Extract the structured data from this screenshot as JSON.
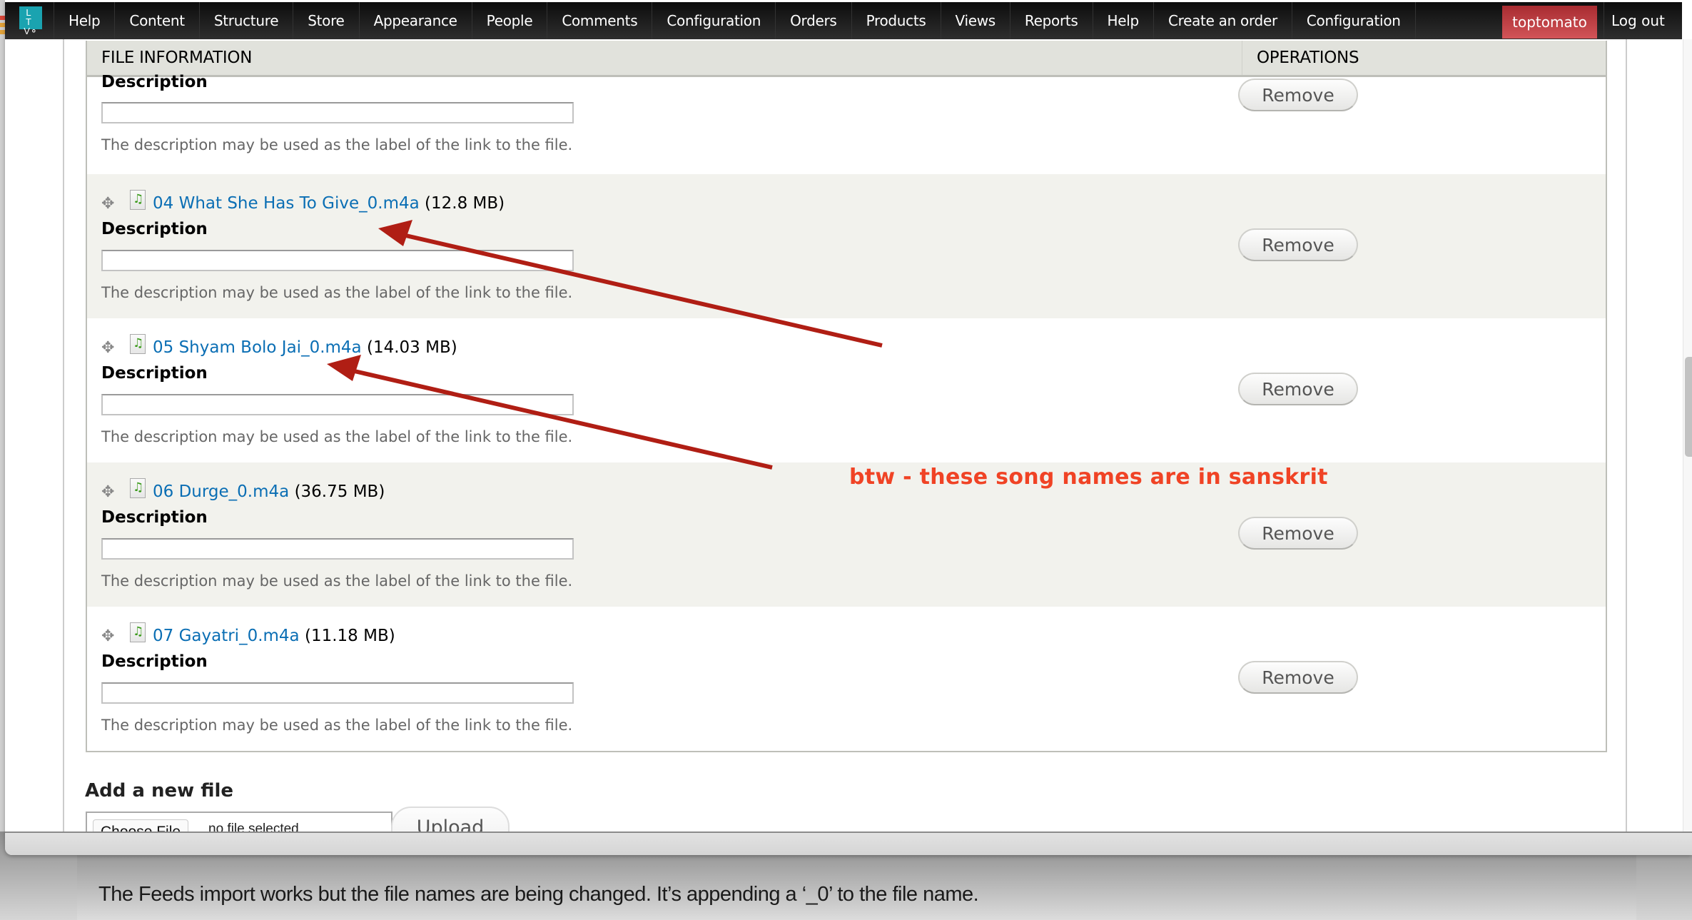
{
  "navbar": {
    "logo_text": "LTV",
    "items": [
      "Help",
      "Content",
      "Structure",
      "Store",
      "Appearance",
      "People",
      "Comments",
      "Configuration",
      "Orders",
      "Products",
      "Views",
      "Reports",
      "Help",
      "Create an order",
      "Configuration"
    ],
    "user": "toptomato",
    "logout": "Log out",
    "user_color": "#c2444a"
  },
  "table": {
    "headers": {
      "file_information": "FILE INFORMATION",
      "operations": "OPERATIONS"
    },
    "partial_row": {
      "description_label": "Description",
      "description_value": "",
      "help_text": "The description may be used as the label of the link to the file.",
      "remove_label": "Remove"
    },
    "rows": [
      {
        "file_name": "04 What She Has To Give_0.m4a",
        "size": "(12.8 MB)",
        "description_label": "Description",
        "description_value": "",
        "help_text": "The description may be used as the label of the link to the file.",
        "remove_label": "Remove"
      },
      {
        "file_name": "05 Shyam Bolo Jai_0.m4a",
        "size": "(14.03 MB)",
        "description_label": "Description",
        "description_value": "",
        "help_text": "The description may be used as the label of the link to the file.",
        "remove_label": "Remove"
      },
      {
        "file_name": "06 Durge_0.m4a",
        "size": "(36.75 MB)",
        "description_label": "Description",
        "description_value": "",
        "help_text": "The description may be used as the label of the link to the file.",
        "remove_label": "Remove"
      },
      {
        "file_name": "07 Gayatri_0.m4a",
        "size": "(11.18 MB)",
        "description_label": "Description",
        "description_value": "",
        "help_text": "The description may be used as the label of the link to the file.",
        "remove_label": "Remove"
      }
    ]
  },
  "add_file": {
    "heading": "Add a new file",
    "choose_label": "Choose File",
    "status": "no file selected",
    "upload_label": "Upload"
  },
  "annotation": {
    "text": "btw - these song names are in sanskrit",
    "color": "#f04325",
    "arrow_color": "#b01e14"
  },
  "background_post": {
    "text": "The Feeds import works but the file names are being changed. It’s appending a ‘_0’ to the file name."
  },
  "icons": {
    "drag_handle": "✥",
    "file_audio": "♫"
  }
}
